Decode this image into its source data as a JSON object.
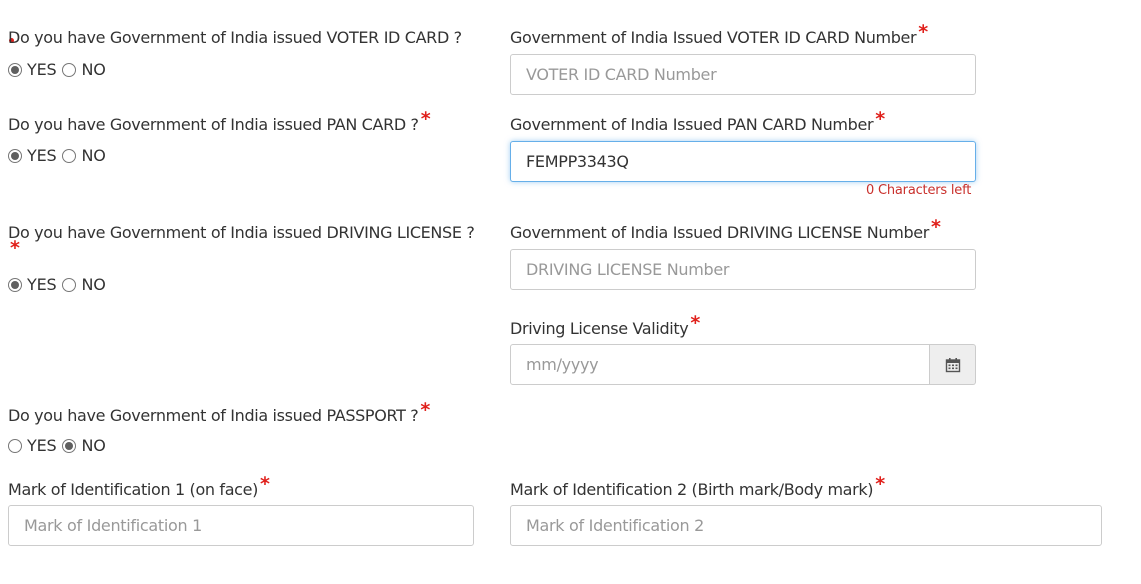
{
  "radio_labels": {
    "yes": "YES",
    "no": "NO"
  },
  "required_mark": "*",
  "voter": {
    "question": "Do you have Government of India issued VOTER ID CARD ?",
    "answer": "YES",
    "number_label": "Government of India Issued VOTER ID CARD Number",
    "number_placeholder": "VOTER ID CARD Number",
    "number_value": ""
  },
  "pan": {
    "question": "Do you have Government of India issued PAN CARD ?",
    "answer": "YES",
    "number_label": "Government of India Issued PAN CARD Number",
    "number_placeholder": "",
    "number_value": "FEMPP3343Q",
    "chars_left": "0 Characters left"
  },
  "driving": {
    "question": "Do you have Government of India issued DRIVING LICENSE ?",
    "answer": "YES",
    "number_label": "Government of India Issued DRIVING LICENSE Number",
    "number_placeholder": "DRIVING LICENSE Number",
    "validity_label": "Driving License Validity",
    "validity_placeholder": "mm/yyyy",
    "calendar_icon": "calendar-icon"
  },
  "passport": {
    "question": "Do you have Government of India issued PASSPORT ?",
    "answer": "NO"
  },
  "marks": {
    "mark1_label": "Mark of Identification 1 (on face)",
    "mark1_placeholder": "Mark of Identification 1",
    "mark2_label": "Mark of Identification 2 (Birth mark/Body mark)",
    "mark2_placeholder": "Mark of Identification 2"
  },
  "colors": {
    "required": "#e0201b",
    "focus": "#66afe9",
    "hint": "#c9302c"
  }
}
